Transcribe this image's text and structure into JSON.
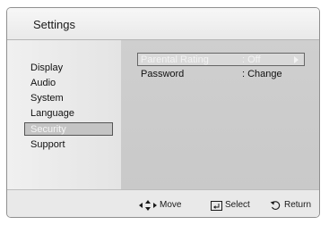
{
  "window": {
    "title": "Settings"
  },
  "sidebar": {
    "items": [
      {
        "label": "Display",
        "selected": false
      },
      {
        "label": "Audio",
        "selected": false
      },
      {
        "label": "System",
        "selected": false
      },
      {
        "label": "Language",
        "selected": false
      },
      {
        "label": "Security",
        "selected": true
      },
      {
        "label": "Support",
        "selected": false
      }
    ]
  },
  "content": {
    "rows": [
      {
        "label": "Parental Rating",
        "value": ": Off",
        "focused": true,
        "disabled": true,
        "icon": "arrow-right-icon"
      },
      {
        "label": "Password",
        "value": ": Change",
        "focused": false,
        "disabled": false
      }
    ]
  },
  "footer": {
    "move_label": "Move",
    "move_icon": "directional-pad-icon",
    "select_label": "Select",
    "select_icon": "enter-icon",
    "return_label": "Return",
    "return_icon": "return-icon"
  }
}
